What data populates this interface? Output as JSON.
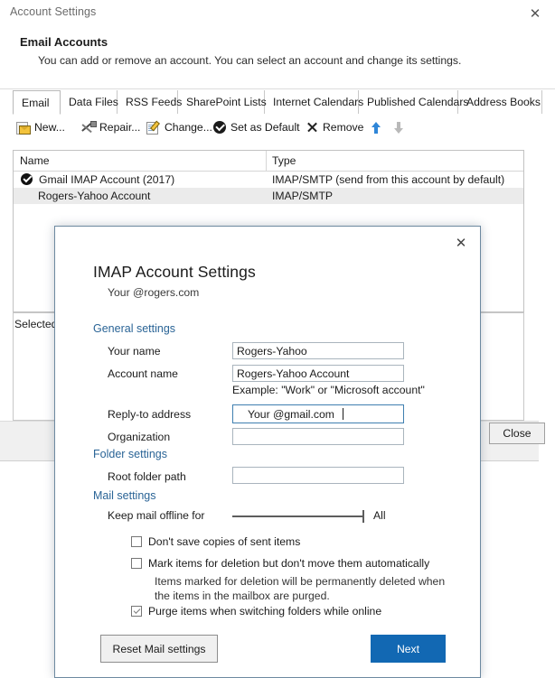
{
  "window": {
    "title": "Account Settings",
    "close_icon": "close-icon",
    "header_title": "Email Accounts",
    "header_subtitle": "You can add or remove an account. You can select an account and change its settings.",
    "selected_label": "Selected",
    "close_button": "Close"
  },
  "tabs": [
    {
      "label": "Email",
      "selected": true
    },
    {
      "label": "Data Files",
      "selected": false
    },
    {
      "label": "RSS Feeds",
      "selected": false
    },
    {
      "label": "SharePoint Lists",
      "selected": false
    },
    {
      "label": "Internet Calendars",
      "selected": false
    },
    {
      "label": "Published Calendars",
      "selected": false
    },
    {
      "label": "Address Books",
      "selected": false
    }
  ],
  "toolbar": {
    "new": "New...",
    "repair": "Repair...",
    "change": "Change...",
    "set_as_default": "Set as Default",
    "remove": "Remove",
    "move_up_icon": "arrow-up-icon",
    "move_down_icon": "arrow-down-icon"
  },
  "accounts_table": {
    "columns": [
      "Name",
      "Type"
    ],
    "rows": [
      {
        "name": "Gmail IMAP Account (2017)",
        "type": "IMAP/SMTP (send from this account by default)",
        "is_default": true,
        "selected": false
      },
      {
        "name": "Rogers-Yahoo Account",
        "type": "IMAP/SMTP",
        "is_default": false,
        "selected": true
      }
    ]
  },
  "modal": {
    "close_icon": "close-icon",
    "title": "IMAP Account Settings",
    "subtitle": "Your @rogers.com",
    "sections": {
      "general": "General settings",
      "folder": "Folder settings",
      "mail": "Mail settings"
    },
    "fields": {
      "your_name_label": "Your name",
      "your_name_value": "Rogers-Yahoo",
      "account_name_label": "Account name",
      "account_name_value": "Rogers-Yahoo Account",
      "account_name_example": "Example: \"Work\" or \"Microsoft account\"",
      "reply_to_label": "Reply-to address",
      "reply_to_value": "Your @gmail.com",
      "organization_label": "Organization",
      "organization_value": "",
      "root_folder_label": "Root folder path",
      "root_folder_value": ""
    },
    "slider": {
      "label": "Keep mail offline for",
      "value": "All",
      "position_percent": 100
    },
    "checkboxes": [
      {
        "label": "Don't save copies of sent items",
        "checked": false
      },
      {
        "label": "Mark items for deletion but don't move them automatically",
        "checked": false
      },
      {
        "label": "Purge items when switching folders while online",
        "checked": true
      }
    ],
    "deletion_hint_line1": "Items marked for deletion will be permanently deleted when",
    "deletion_hint_line2": "the items in the mailbox are purged.",
    "reset_button": "Reset Mail settings",
    "next_button": "Next"
  },
  "colors": {
    "accent_blue": "#1268b3",
    "section_heading": "#2a6496",
    "modal_border": "#6d89a0",
    "selected_row": "#ebebeb"
  }
}
